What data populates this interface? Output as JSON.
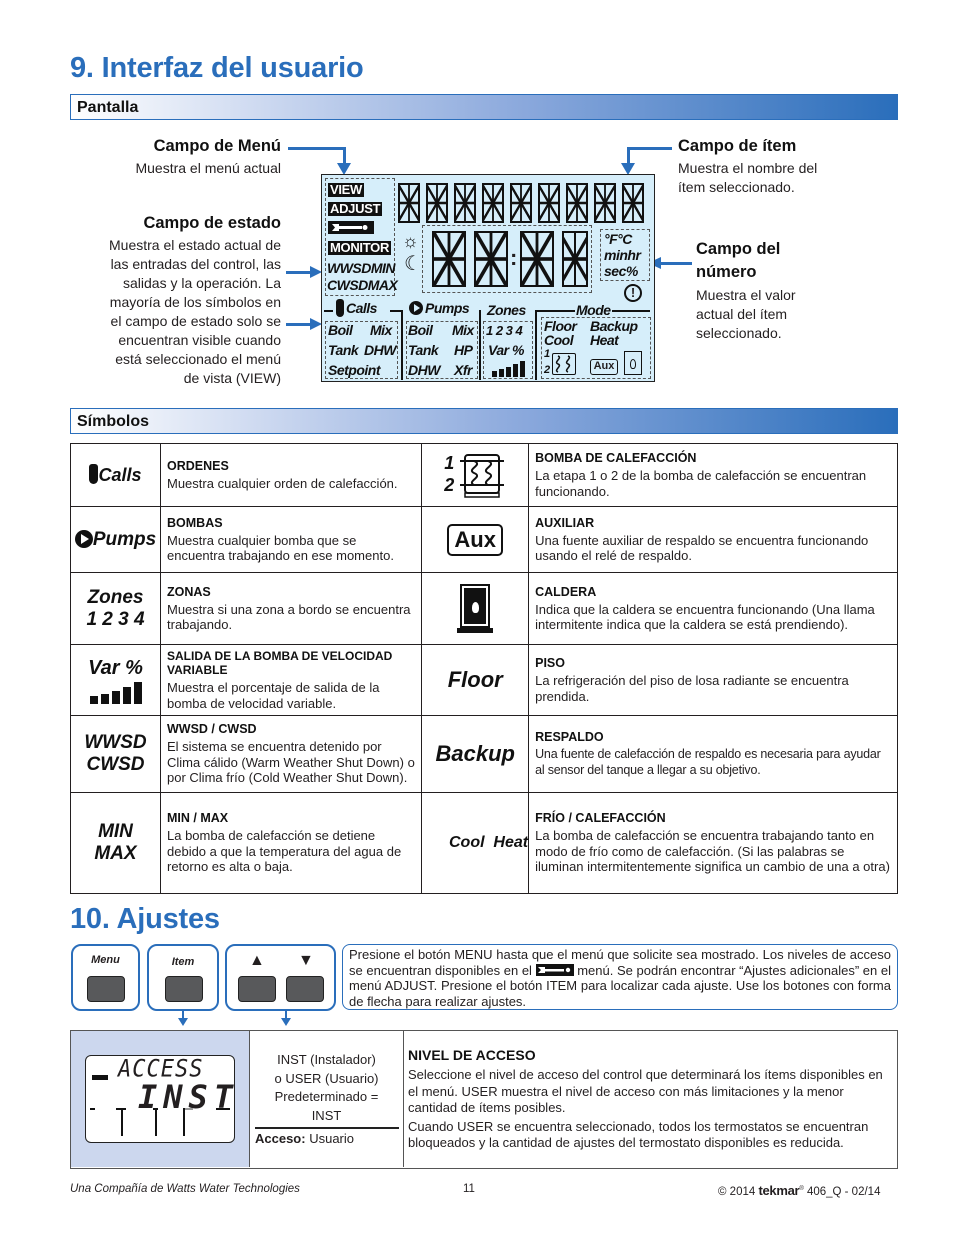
{
  "section9": {
    "title": "9. Interfaz del usuario",
    "display_bar": "Pantalla",
    "callouts": {
      "menu_field": {
        "title": "Campo de Menú",
        "text": "Muestra el menú actual"
      },
      "status_field": {
        "title": "Campo de estado",
        "lines": [
          "Muestra el estado actual de",
          "las entradas del control, las",
          "salidas y la operación. La",
          "mayoría de los símbolos en",
          "el campo de estado solo se",
          "encuentran visible cuando",
          "está seleccionado el menú",
          "de vista (VIEW)"
        ]
      },
      "item_field": {
        "title": "Campo de ítem",
        "lines": [
          "Muestra el nombre del",
          "ítem seleccionado."
        ]
      },
      "number_field": {
        "title_lines": [
          "Campo del",
          "número"
        ],
        "lines": [
          "Muestra el valor",
          "actual del ítem",
          "seleccionado."
        ]
      }
    },
    "lcd": {
      "menu_tags": [
        "VIEW",
        "ADJUST",
        "MONITOR"
      ],
      "status_words": [
        "WWSDMIN",
        "CWSDMAX"
      ],
      "units": [
        "°F°C",
        "minhr",
        "sec%"
      ],
      "group_labels": {
        "calls": "Calls",
        "pumps": "Pumps",
        "zones": "Zones",
        "mode": "Mode"
      },
      "calls_items": [
        [
          "Boil",
          "Mix"
        ],
        [
          "Tank",
          "DHW"
        ],
        [
          "Setpoint",
          ""
        ]
      ],
      "pumps_items": [
        [
          "Boil",
          "Mix"
        ],
        [
          "Tank",
          "HP"
        ],
        [
          "DHW",
          "Xfr"
        ]
      ],
      "zones_numbers": "1 2 3 4",
      "var_label": "Var %",
      "mode_items": [
        [
          "Floor",
          "Backup"
        ],
        [
          "Cool",
          "Heat"
        ]
      ],
      "stage_numbers": [
        "1",
        "2"
      ],
      "aux_label": "Aux",
      "alert_symbol": "!"
    },
    "symbols_bar": "Símbolos",
    "symbols": [
      {
        "left": {
          "icon_text": [
            "Calls"
          ],
          "icon": "thermometer-icon",
          "title": "ORDENES",
          "text": "Muestra cualquier orden de calefacción."
        },
        "right": {
          "icon_text": [
            "1",
            "2"
          ],
          "icon": "heat-pump-stage-icon",
          "title": "BOMBA DE CALEFACCIÓN",
          "text": "La etapa 1 o 2 de la bomba de calefacción se encuentran funcionando."
        }
      },
      {
        "left": {
          "icon_text": [
            "Pumps"
          ],
          "icon": "pump-icon",
          "title": "BOMBAS",
          "text": "Muestra cualquier bomba que se encuentra trabajando en ese momento."
        },
        "right": {
          "icon_text": [
            "Aux"
          ],
          "icon": "aux-icon",
          "title": "AUXILIAR",
          "text": "Una fuente auxiliar de respaldo se encuentra funcionando usando el relé de respaldo."
        }
      },
      {
        "left": {
          "icon_text": [
            "Zones",
            "1 2 3 4"
          ],
          "icon": "zones-icon",
          "title": "ZONAS",
          "text": "Muestra si una zona a bordo se encuentra trabajando."
        },
        "right": {
          "icon_text": [],
          "icon": "boiler-flame-icon",
          "title": "CALDERA",
          "text": "Indica que la caldera se encuentra funcionando (Una llama intermitente indica que la caldera se está prendiendo)."
        }
      },
      {
        "left": {
          "icon_text": [
            "Var %"
          ],
          "icon": "signal-bars-icon",
          "title": "SALIDA DE LA BOMBA DE VELOCIDAD VARIABLE",
          "text": "Muestra el porcentaje de salida de la bomba de velocidad variable."
        },
        "right": {
          "icon_text": [
            "Floor"
          ],
          "icon": "floor-icon",
          "title": "PISO",
          "text": "La refrigeración del piso de losa radiante se encuentra prendida."
        }
      },
      {
        "left": {
          "icon_text": [
            "WWSD",
            "CWSD"
          ],
          "icon": "wwsd-cwsd-icon",
          "title": "WWSD / CWSD",
          "text": "El sistema se encuentra detenido por Clima cálido (Warm Weather Shut Down) o por Clima frío (Cold Weather Shut Down)."
        },
        "right": {
          "icon_text": [
            "Backup"
          ],
          "icon": "backup-icon",
          "title": "RESPALDO",
          "text": "Una fuente de calefacción de respaldo es necesaria para ayudar al sensor del tanque a llegar a su objetivo."
        }
      },
      {
        "left": {
          "icon_text": [
            "MIN",
            "MAX"
          ],
          "icon": "min-max-icon",
          "title": "MIN / MAX",
          "text": "La bomba de calefacción se detiene debido a que la temperatura del agua de retorno es alta o baja."
        },
        "right": {
          "icon_text": [
            "Cool  Heat"
          ],
          "icon": "cool-heat-icon",
          "title": "FRÍO / CALEFACCIÓN",
          "text": "La bomba de calefacción se encuentra trabajando tanto en modo de frío como de calefacción. (Si las palabras se iluminan intermitentemente significa un cambio de una a otra)"
        }
      }
    ]
  },
  "section10": {
    "title": "10. Ajustes",
    "buttons": {
      "menu": "Menu",
      "item": "Item",
      "up": "▲",
      "down": "▼"
    },
    "instructions": {
      "part1": "Presione el botón MENU hasta que el menú que solicite sea mostrado. Los niveles de acceso se encuentran disponibles en el",
      "part2": "menú. Se podrán encontrar “Ajustes adicionales” en el menú ADJUST. Presione el botón ITEM para localizar cada ajuste. Use los botones con forma de flecha para realizar ajustes."
    },
    "setting": {
      "lcd_top": "ACCESS",
      "lcd_value": "INST",
      "options_lines": [
        "INST (Instalador)",
        "o USER (Usuario)",
        "Predeterminado =",
        "INST"
      ],
      "access_label": "Acceso:",
      "access_value": "Usuario",
      "title": "NIVEL DE ACCESO",
      "paragraph1": "Seleccione el nivel de acceso del control que determinará los ítems disponibles en el menú. USER muestra el nivel de acceso con más limitaciones y la menor cantidad de ítems posibles.",
      "paragraph2": "Cuando USER se encuentra seleccionado, todos los termostatos se encuentran bloqueados y la cantidad de ajustes del termostato disponibles es reducida."
    }
  },
  "footer": {
    "left": "Una Compañía de Watts Water Technologies",
    "page": "11",
    "copyright": "© 2014",
    "brand": "tekmar",
    "doc": "406_Q - 02/14"
  }
}
